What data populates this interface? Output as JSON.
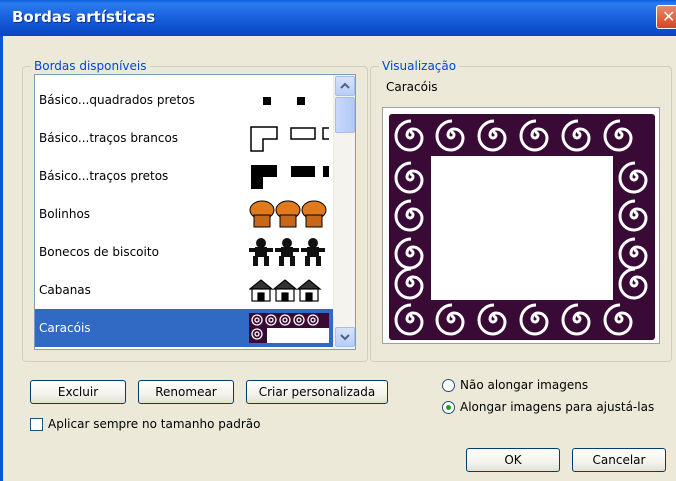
{
  "window": {
    "title": "Bordas artísticas",
    "close_glyph": "✕"
  },
  "available": {
    "label": "Bordas disponíveis",
    "items": [
      {
        "label": "Básico...quadrados pretos",
        "preview": "black-squares"
      },
      {
        "label": "Básico...traços brancos",
        "preview": "white-strokes"
      },
      {
        "label": "Básico...traços pretos",
        "preview": "black-strokes"
      },
      {
        "label": "Bolinhos",
        "preview": "muffins"
      },
      {
        "label": "Bonecos de biscoito",
        "preview": "gingerbread"
      },
      {
        "label": "Cabanas",
        "preview": "cabins"
      },
      {
        "label": "Caracóis",
        "preview": "snails",
        "selected": true
      }
    ]
  },
  "preview": {
    "group_label": "Visualização",
    "name": "Caracóis"
  },
  "buttons": {
    "delete": "Excluir",
    "rename": "Renomear",
    "custom": "Criar personalizada",
    "ok": "OK",
    "cancel": "Cancelar"
  },
  "options": {
    "no_stretch": "Não alongar imagens",
    "stretch": "Alongar imagens para ajustá-las",
    "selected": "stretch",
    "always_default": "Aplicar sempre no tamanho padrão",
    "always_default_checked": false
  },
  "colors": {
    "accent": "#316ac5",
    "group_label": "#0046d5",
    "title_bar": "#1a63df",
    "border_frame": "#3a0a36"
  }
}
